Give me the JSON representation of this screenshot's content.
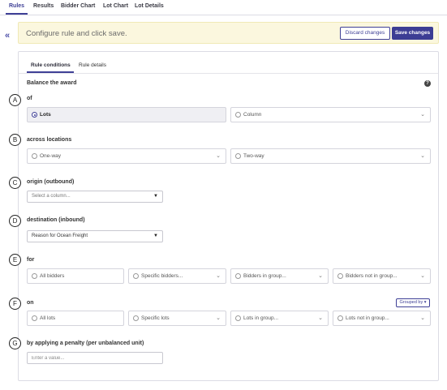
{
  "nav": {
    "tabs": [
      {
        "label": "Rules",
        "active": true
      },
      {
        "label": "Results"
      },
      {
        "label": "Bidder Chart"
      },
      {
        "label": "Lot Chart"
      },
      {
        "label": "Lot Details"
      }
    ],
    "collapse_glyph": "«"
  },
  "banner": {
    "message": "Configure rule and click save.",
    "discard_label": "Discard changes",
    "save_label": "Save changes"
  },
  "subtabs": [
    {
      "label": "Rule conditions",
      "active": true
    },
    {
      "label": "Rule details"
    }
  ],
  "section_title": "Balance the award",
  "help_glyph": "?",
  "markers": [
    "A",
    "B",
    "C",
    "D",
    "E",
    "F",
    "G"
  ],
  "of": {
    "label": "of",
    "options": [
      {
        "label": "Lots",
        "selected": true
      },
      {
        "label": "Column"
      }
    ]
  },
  "across": {
    "label": "across locations",
    "options": [
      {
        "label": "One-way"
      },
      {
        "label": "Two-way"
      }
    ]
  },
  "origin": {
    "label": "origin (outbound)",
    "placeholder": "Select a column..."
  },
  "destination": {
    "label": "destination (inbound)",
    "value": "Reason for Ocean Freight"
  },
  "for_section": {
    "label": "for",
    "options": [
      {
        "label": "All bidders"
      },
      {
        "label": "Specific bidders..."
      },
      {
        "label": "Bidders in group..."
      },
      {
        "label": "Bidders not in group..."
      }
    ]
  },
  "on_section": {
    "label": "on",
    "grouped_by": "Grouped by ▾",
    "options": [
      {
        "label": "All lots"
      },
      {
        "label": "Specific lots"
      },
      {
        "label": "Lots in group..."
      },
      {
        "label": "Lots not in group..."
      }
    ]
  },
  "penalty": {
    "label": "by applying a penalty (per unbalanced unit)",
    "placeholder": "Enter a value..."
  },
  "colors": {
    "accent": "#3f4096",
    "banner_bg": "#fbf7de",
    "selected_bg": "#efeff3"
  }
}
